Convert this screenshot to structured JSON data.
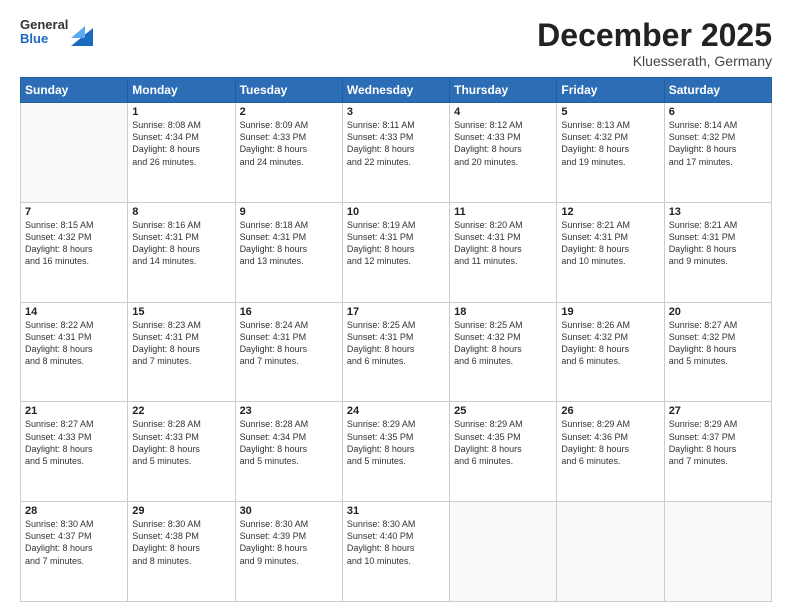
{
  "header": {
    "logo": {
      "general": "General",
      "blue": "Blue"
    },
    "title": "December 2025",
    "location": "Kluesserath, Germany"
  },
  "days_of_week": [
    "Sunday",
    "Monday",
    "Tuesday",
    "Wednesday",
    "Thursday",
    "Friday",
    "Saturday"
  ],
  "weeks": [
    [
      {
        "day": "",
        "info": ""
      },
      {
        "day": "1",
        "info": "Sunrise: 8:08 AM\nSunset: 4:34 PM\nDaylight: 8 hours\nand 26 minutes."
      },
      {
        "day": "2",
        "info": "Sunrise: 8:09 AM\nSunset: 4:33 PM\nDaylight: 8 hours\nand 24 minutes."
      },
      {
        "day": "3",
        "info": "Sunrise: 8:11 AM\nSunset: 4:33 PM\nDaylight: 8 hours\nand 22 minutes."
      },
      {
        "day": "4",
        "info": "Sunrise: 8:12 AM\nSunset: 4:33 PM\nDaylight: 8 hours\nand 20 minutes."
      },
      {
        "day": "5",
        "info": "Sunrise: 8:13 AM\nSunset: 4:32 PM\nDaylight: 8 hours\nand 19 minutes."
      },
      {
        "day": "6",
        "info": "Sunrise: 8:14 AM\nSunset: 4:32 PM\nDaylight: 8 hours\nand 17 minutes."
      }
    ],
    [
      {
        "day": "7",
        "info": "Sunrise: 8:15 AM\nSunset: 4:32 PM\nDaylight: 8 hours\nand 16 minutes."
      },
      {
        "day": "8",
        "info": "Sunrise: 8:16 AM\nSunset: 4:31 PM\nDaylight: 8 hours\nand 14 minutes."
      },
      {
        "day": "9",
        "info": "Sunrise: 8:18 AM\nSunset: 4:31 PM\nDaylight: 8 hours\nand 13 minutes."
      },
      {
        "day": "10",
        "info": "Sunrise: 8:19 AM\nSunset: 4:31 PM\nDaylight: 8 hours\nand 12 minutes."
      },
      {
        "day": "11",
        "info": "Sunrise: 8:20 AM\nSunset: 4:31 PM\nDaylight: 8 hours\nand 11 minutes."
      },
      {
        "day": "12",
        "info": "Sunrise: 8:21 AM\nSunset: 4:31 PM\nDaylight: 8 hours\nand 10 minutes."
      },
      {
        "day": "13",
        "info": "Sunrise: 8:21 AM\nSunset: 4:31 PM\nDaylight: 8 hours\nand 9 minutes."
      }
    ],
    [
      {
        "day": "14",
        "info": "Sunrise: 8:22 AM\nSunset: 4:31 PM\nDaylight: 8 hours\nand 8 minutes."
      },
      {
        "day": "15",
        "info": "Sunrise: 8:23 AM\nSunset: 4:31 PM\nDaylight: 8 hours\nand 7 minutes."
      },
      {
        "day": "16",
        "info": "Sunrise: 8:24 AM\nSunset: 4:31 PM\nDaylight: 8 hours\nand 7 minutes."
      },
      {
        "day": "17",
        "info": "Sunrise: 8:25 AM\nSunset: 4:31 PM\nDaylight: 8 hours\nand 6 minutes."
      },
      {
        "day": "18",
        "info": "Sunrise: 8:25 AM\nSunset: 4:32 PM\nDaylight: 8 hours\nand 6 minutes."
      },
      {
        "day": "19",
        "info": "Sunrise: 8:26 AM\nSunset: 4:32 PM\nDaylight: 8 hours\nand 6 minutes."
      },
      {
        "day": "20",
        "info": "Sunrise: 8:27 AM\nSunset: 4:32 PM\nDaylight: 8 hours\nand 5 minutes."
      }
    ],
    [
      {
        "day": "21",
        "info": "Sunrise: 8:27 AM\nSunset: 4:33 PM\nDaylight: 8 hours\nand 5 minutes."
      },
      {
        "day": "22",
        "info": "Sunrise: 8:28 AM\nSunset: 4:33 PM\nDaylight: 8 hours\nand 5 minutes."
      },
      {
        "day": "23",
        "info": "Sunrise: 8:28 AM\nSunset: 4:34 PM\nDaylight: 8 hours\nand 5 minutes."
      },
      {
        "day": "24",
        "info": "Sunrise: 8:29 AM\nSunset: 4:35 PM\nDaylight: 8 hours\nand 5 minutes."
      },
      {
        "day": "25",
        "info": "Sunrise: 8:29 AM\nSunset: 4:35 PM\nDaylight: 8 hours\nand 6 minutes."
      },
      {
        "day": "26",
        "info": "Sunrise: 8:29 AM\nSunset: 4:36 PM\nDaylight: 8 hours\nand 6 minutes."
      },
      {
        "day": "27",
        "info": "Sunrise: 8:29 AM\nSunset: 4:37 PM\nDaylight: 8 hours\nand 7 minutes."
      }
    ],
    [
      {
        "day": "28",
        "info": "Sunrise: 8:30 AM\nSunset: 4:37 PM\nDaylight: 8 hours\nand 7 minutes."
      },
      {
        "day": "29",
        "info": "Sunrise: 8:30 AM\nSunset: 4:38 PM\nDaylight: 8 hours\nand 8 minutes."
      },
      {
        "day": "30",
        "info": "Sunrise: 8:30 AM\nSunset: 4:39 PM\nDaylight: 8 hours\nand 9 minutes."
      },
      {
        "day": "31",
        "info": "Sunrise: 8:30 AM\nSunset: 4:40 PM\nDaylight: 8 hours\nand 10 minutes."
      },
      {
        "day": "",
        "info": ""
      },
      {
        "day": "",
        "info": ""
      },
      {
        "day": "",
        "info": ""
      }
    ]
  ]
}
